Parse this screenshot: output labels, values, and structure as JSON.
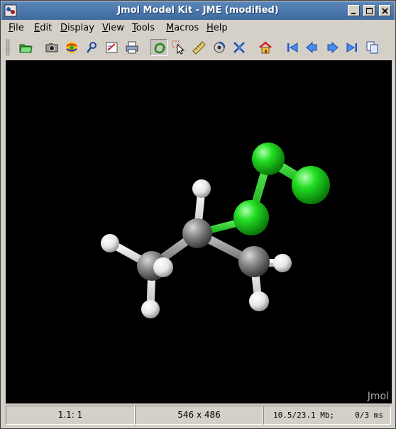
{
  "window": {
    "title": "Jmol Model Kit - JME (modified)",
    "buttons": [
      {
        "name": "minimize-button",
        "icon": "minimize-icon",
        "glyph": "_"
      },
      {
        "name": "maximize-button",
        "icon": "maximize-icon",
        "glyph": "□"
      },
      {
        "name": "close-button",
        "icon": "close-icon",
        "glyph": "×"
      }
    ]
  },
  "menu": {
    "items": [
      {
        "label": "File",
        "mnemonic": "F"
      },
      {
        "label": "Edit",
        "mnemonic": "E"
      },
      {
        "label": "Display",
        "mnemonic": "D"
      },
      {
        "label": "View",
        "mnemonic": "V"
      },
      {
        "label": "Tools",
        "mnemonic": "T"
      },
      {
        "label": "Macros",
        "mnemonic": "M"
      },
      {
        "label": "Help",
        "mnemonic": "H"
      }
    ]
  },
  "toolbar": {
    "buttons": [
      {
        "icon": "open-folder-icon",
        "pressed": false
      },
      {
        "icon": "camera-icon",
        "pressed": false
      },
      {
        "icon": "povray-icon",
        "pressed": false
      },
      {
        "icon": "pdb-viewer-icon",
        "pressed": false
      },
      {
        "icon": "script-editor-icon",
        "pressed": false
      },
      {
        "icon": "print-icon",
        "pressed": false
      },
      {
        "icon": "rotate-icon",
        "pressed": true
      },
      {
        "icon": "pick-icon",
        "pressed": false
      },
      {
        "icon": "measure-icon",
        "pressed": false
      },
      {
        "icon": "spin-icon",
        "pressed": false
      },
      {
        "icon": "model-kit-icon",
        "pressed": false
      },
      {
        "icon": "home-icon",
        "pressed": false
      },
      {
        "icon": "first-frame-icon",
        "pressed": false
      },
      {
        "icon": "previous-frame-icon",
        "pressed": false
      },
      {
        "icon": "next-frame-icon",
        "pressed": false
      },
      {
        "icon": "last-frame-icon",
        "pressed": false
      },
      {
        "icon": "copy-icon",
        "pressed": false
      }
    ]
  },
  "viewer": {
    "background": "#000000",
    "watermark": "Jmol",
    "colors": {
      "carbon": "#909090",
      "hydrogen": "#ffffff",
      "chlorine": "#1ff01f"
    }
  },
  "status": {
    "frame": "1.1: 1",
    "size": "546 x 486",
    "memory": "10.5/23.1 Mb;",
    "timing": "0/3 ms"
  }
}
